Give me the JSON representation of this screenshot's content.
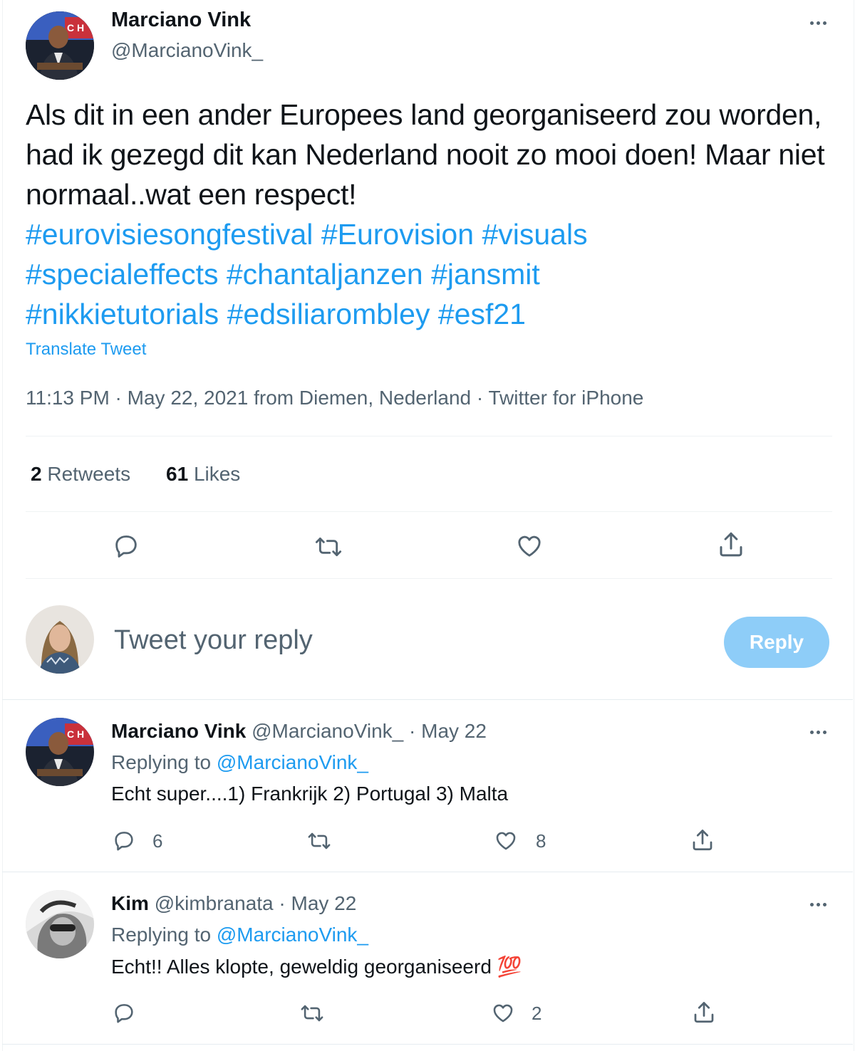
{
  "main_tweet": {
    "author_name": "Marciano Vink",
    "author_handle": "@MarcianoVink_",
    "text": "Als dit in een ander Europees land georganiseerd zou worden, had ik gezegd dit kan Nederland nooit zo mooi doen! Maar niet normaal..wat een respect!",
    "hashtags_line1": [
      "#eurovisiesongfestival",
      "#Eurovision",
      "#visuals"
    ],
    "hashtags_line2": [
      "#specialeffects",
      "#chantaljanzen",
      "#jansmit"
    ],
    "hashtags_line3": [
      "#nikkietutorials",
      "#edsiliarombley",
      "#esf21"
    ],
    "translate_label": "Translate Tweet",
    "timestamp": "11:13 PM · May 22, 2021 from Diemen, Nederland · Twitter for iPhone",
    "retweets_count": "2",
    "retweets_label": "Retweets",
    "likes_count": "61",
    "likes_label": "Likes"
  },
  "reply_box": {
    "placeholder": "Tweet your reply",
    "button_label": "Reply"
  },
  "replies": [
    {
      "author_name": "Marciano Vink",
      "author_handle": "@MarcianoVink_",
      "date": "· May 22",
      "replying_prefix": "Replying to",
      "replying_to": "@MarcianoVink_",
      "text": "Echt super....1) Frankrijk 2) Portugal 3) Malta",
      "reply_count": "6",
      "retweet_count": "",
      "like_count": "8"
    },
    {
      "author_name": "Kim",
      "author_handle": "@kimbranata",
      "date": "· May 22",
      "replying_prefix": "Replying to",
      "replying_to": "@MarcianoVink_",
      "text": "Echt!! Alles klopte, geweldig georganiseerd 💯",
      "reply_count": "",
      "retweet_count": "",
      "like_count": "2"
    }
  ],
  "colors": {
    "accent": "#1d9bf0",
    "muted_text": "#536471",
    "reply_button_disabled": "#8ecdf8",
    "divider": "#eff3f4"
  },
  "icons": [
    "more-icon",
    "reply-icon",
    "retweet-icon",
    "like-icon",
    "share-icon"
  ]
}
